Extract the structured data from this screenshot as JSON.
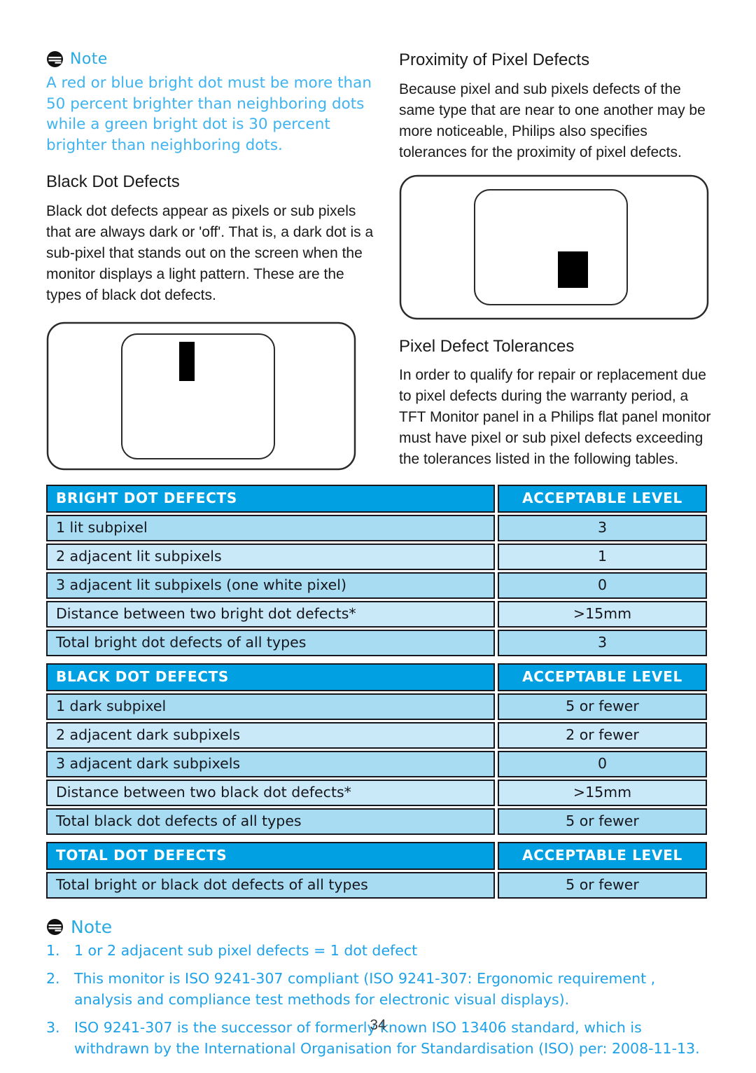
{
  "page_number": "34",
  "colors": {
    "note_blue": "#29ABE2",
    "note_body_blue": "#3FB3F0",
    "table_header_blue": "#00A0E3",
    "table_band_a": "#A8DCF2",
    "table_band_b": "#C9E9F9",
    "list_blue": "#1DA1E8",
    "text_black": "#1a1a1a"
  },
  "top_note": {
    "icon": "note-icon",
    "title": "Note",
    "body": "A red or blue bright dot must be more than 50 percent brighter than neighboring dots while a green bright dot is 30 percent brighter than neighboring dots."
  },
  "left_column": {
    "heading": "Black Dot Defects",
    "paragraph": "Black dot defects appear as pixels or sub pixels that are always dark or 'off'. That is, a dark dot is a sub-pixel that stands out on the screen when the monitor displays a light pattern. These are the types of black dot defects.",
    "diagram": {
      "name": "black-dot-defect-diagram",
      "description": "Monitor outline with inner screen panel containing one tall black subpixel defect mark near top center"
    }
  },
  "right_column": {
    "heading_proximity": "Proximity of Pixel Defects",
    "paragraph_proximity": "Because pixel and sub pixels defects of the same type that are near to one another may be more noticeable, Philips also specifies tolerances for the proximity of pixel defects.",
    "diagram": {
      "name": "pixel-defect-proximity-diagram",
      "description": "Monitor outline with inner screen panel containing one black pixel defect block"
    },
    "heading_tolerances": "Pixel Defect Tolerances",
    "paragraph_tolerances": "In order to qualify for repair or replacement due to pixel defects during the warranty period, a TFT Monitor panel in a Philips flat panel monitor must have pixel or sub pixel defects exceeding the tolerances listed in the following tables."
  },
  "tables": [
    {
      "id": "bright-dot-defects",
      "header": {
        "left": "BRIGHT DOT DEFECTS",
        "right": "ACCEPTABLE LEVEL"
      },
      "rows": [
        {
          "left": "1 lit subpixel",
          "right": "3"
        },
        {
          "left": "2 adjacent lit subpixels",
          "right": "1"
        },
        {
          "left": "3 adjacent lit subpixels (one white pixel)",
          "right": "0"
        },
        {
          "left": "Distance between two bright dot defects*",
          "right": ">15mm"
        },
        {
          "left": "Total bright dot defects of all types",
          "right": "3"
        }
      ]
    },
    {
      "id": "black-dot-defects",
      "header": {
        "left": "BLACK DOT DEFECTS",
        "right": "ACCEPTABLE LEVEL"
      },
      "rows": [
        {
          "left": "1 dark subpixel",
          "right": "5 or fewer"
        },
        {
          "left": "2 adjacent dark subpixels",
          "right": "2 or fewer"
        },
        {
          "left": "3 adjacent dark subpixels",
          "right": "0"
        },
        {
          "left": "Distance between two black dot defects*",
          "right": ">15mm"
        },
        {
          "left": "Total black dot defects of all types",
          "right": "5 or fewer"
        }
      ]
    },
    {
      "id": "total-dot-defects",
      "header": {
        "left": "TOTAL DOT DEFECTS",
        "right": "ACCEPTABLE LEVEL"
      },
      "rows": [
        {
          "left": "Total bright or black dot defects of all types",
          "right": "5 or fewer"
        }
      ]
    }
  ],
  "bottom_note": {
    "icon": "note-icon",
    "title": "Note",
    "items": [
      {
        "num": "1.",
        "text": "1 or 2 adjacent sub pixel defects = 1 dot defect"
      },
      {
        "num": "2.",
        "text": "This monitor is ISO 9241-307 compliant (ISO 9241-307: Ergonomic requirement , analysis and compliance test methods for electronic visual displays)."
      },
      {
        "num": "3.",
        "text": "ISO 9241-307 is the successor of formerly known ISO 13406 standard, which is withdrawn by the International Organisation for Standardisation (ISO) per: 2008-11-13."
      }
    ]
  }
}
